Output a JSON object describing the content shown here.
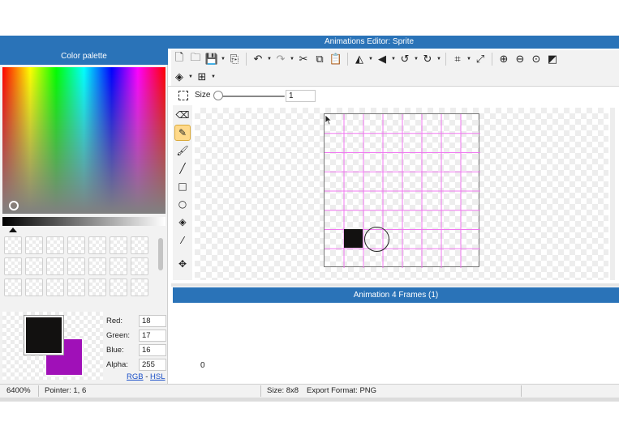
{
  "window": {
    "title": "Animations Editor: Sprite"
  },
  "palette": {
    "title": "Color palette",
    "swatch_count": 21,
    "foreground_color": "#121110",
    "background_color": "#a010b8",
    "rgba": [
      {
        "label": "Red:",
        "value": "18"
      },
      {
        "label": "Green:",
        "value": "17"
      },
      {
        "label": "Blue:",
        "value": "16"
      },
      {
        "label": "Alpha:",
        "value": "255"
      }
    ],
    "mode_rgb": "RGB",
    "mode_sep": " - ",
    "mode_hsl": "HSL"
  },
  "toolbar": {
    "row1_icons": [
      "new-file-icon",
      "open-folder-icon",
      "save-icon",
      "export-icon",
      "undo-icon",
      "redo-icon",
      "cut-icon",
      "copy-icon",
      "paste-icon",
      "flip-horizontal-icon",
      "flip-vertical-icon",
      "rotate-left-icon",
      "rotate-right-icon",
      "crop-icon",
      "resize-icon",
      "zoom-in-icon",
      "zoom-out-icon",
      "zoom-fit-icon",
      "toggle-bg-icon"
    ],
    "row2_icons": [
      "layers-icon",
      "grid-toggle-icon"
    ],
    "size_label": "Size",
    "size_value": "1"
  },
  "tools": [
    "eraser-icon",
    "pencil-icon",
    "brush-icon",
    "line-icon",
    "rectangle-icon",
    "ellipse-icon",
    "fill-icon",
    "eyedropper-icon",
    "transform-icon"
  ],
  "canvas": {
    "grid_columns": 8,
    "grid_rows": 8,
    "pixel_color": "#121110",
    "grid_color": "#f078f0"
  },
  "animation": {
    "title": "Animation 4 Frames (1)",
    "frame_number": "0"
  },
  "status": {
    "zoom": "6400%",
    "pointer": "Pointer: 1, 6",
    "size": "Size: 8x8",
    "format": "Export Format: PNG"
  }
}
